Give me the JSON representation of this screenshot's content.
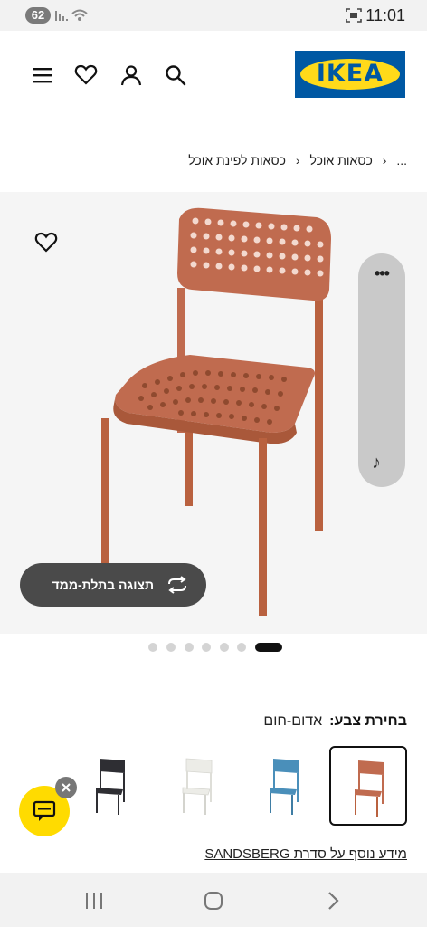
{
  "status_bar": {
    "battery": "62",
    "time": "11:01"
  },
  "header": {
    "logo_text": "IKEA",
    "icons": [
      "menu-icon",
      "heart-icon",
      "user-icon",
      "search-icon"
    ],
    "colors": {
      "logo_blue": "#0058a3",
      "logo_yellow": "#ffda1a"
    }
  },
  "breadcrumb": {
    "ellipsis": "...",
    "items": [
      "כסאות אוכל",
      "כסאות לפינת אוכל"
    ]
  },
  "gallery": {
    "view_3d_label": "תצוגה בתלת-ממד",
    "side_panel_more": "•••",
    "side_panel_icon": "music-note-icon",
    "image_count": 7,
    "active_image_index": 6
  },
  "color_selection": {
    "label": "בחירת צבע:",
    "selected_value": "אדום-חום",
    "options": [
      "red-brown",
      "blue",
      "white",
      "black"
    ],
    "colors": {
      "red-brown": "#c06b4f",
      "blue": "#4a8fba",
      "white": "#ecece7",
      "black": "#2e2e33"
    }
  },
  "series_link": "מידע נוסף על סדרת SANDSBERG",
  "chat": {
    "icon": "chat-icon",
    "close_icon": "close-icon",
    "color": "#ffdb00"
  },
  "nav_bar": {
    "buttons": [
      "recents-icon",
      "home-icon",
      "back-icon"
    ]
  }
}
